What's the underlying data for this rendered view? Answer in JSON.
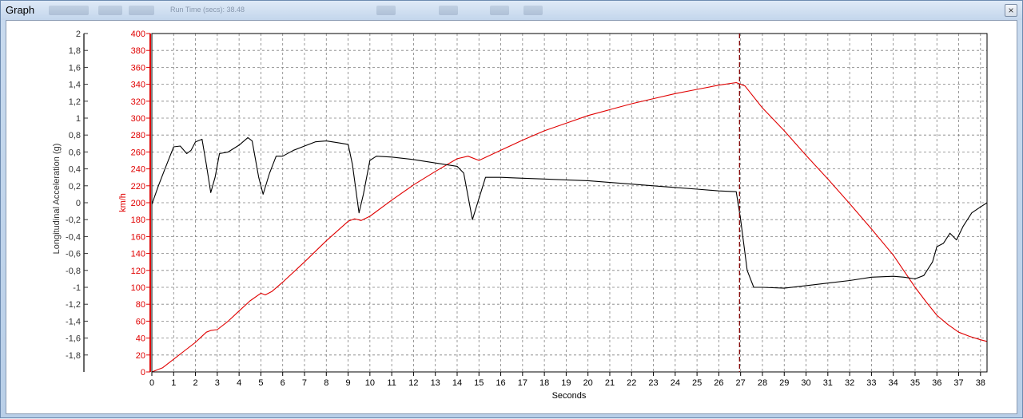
{
  "window": {
    "title": "Graph",
    "header_readout": "Run Time (secs): 38.48",
    "close_glyph": "×"
  },
  "colors": {
    "speed": "#e00000",
    "acceleration": "#000000",
    "grid": "#808080",
    "marker": "#800000"
  },
  "chart_data": {
    "type": "line",
    "title": "",
    "xlabel": "Seconds",
    "xlim": [
      0,
      38.3
    ],
    "x_ticks": [
      0,
      1,
      2,
      3,
      4,
      5,
      6,
      7,
      8,
      9,
      10,
      11,
      12,
      13,
      14,
      15,
      16,
      17,
      18,
      19,
      20,
      21,
      22,
      23,
      24,
      25,
      26,
      27,
      28,
      29,
      30,
      31,
      32,
      33,
      34,
      35,
      36,
      37,
      38
    ],
    "grid": true,
    "cursor_x": 26.95,
    "y_axes": [
      {
        "id": "speed",
        "label": "km/h",
        "color": "#e00000",
        "lim": [
          0,
          400
        ],
        "ticks": [
          "0",
          "20",
          "40",
          "60",
          "80",
          "100",
          "120",
          "140",
          "160",
          "180",
          "200",
          "220",
          "240",
          "260",
          "280",
          "300",
          "320",
          "340",
          "360",
          "380",
          "400"
        ]
      },
      {
        "id": "accel",
        "label": "Longitudinal Acceleration (g)",
        "color": "#333333",
        "lim": [
          -2,
          2
        ],
        "ticks": [
          "-1,8",
          "-1,6",
          "-1,4",
          "-1,2",
          "-1",
          "-0,8",
          "-0,6",
          "-0,4",
          "-0,2",
          "0",
          "0,2",
          "0,4",
          "0,6",
          "0,8",
          "1",
          "1,2",
          "1,4",
          "1,6",
          "1,8",
          "2"
        ]
      }
    ],
    "series": [
      {
        "axis": "speed",
        "color": "#e00000",
        "points": [
          [
            0,
            0
          ],
          [
            0.5,
            5
          ],
          [
            1,
            15
          ],
          [
            1.5,
            25
          ],
          [
            2,
            35
          ],
          [
            2.5,
            47
          ],
          [
            2.7,
            49
          ],
          [
            3,
            50
          ],
          [
            3.5,
            60
          ],
          [
            4,
            72
          ],
          [
            4.5,
            84
          ],
          [
            5,
            93
          ],
          [
            5.2,
            91
          ],
          [
            5.5,
            95
          ],
          [
            6,
            106
          ],
          [
            7,
            130
          ],
          [
            8,
            155
          ],
          [
            9,
            178
          ],
          [
            9.3,
            181
          ],
          [
            9.6,
            179
          ],
          [
            10,
            184
          ],
          [
            11,
            203
          ],
          [
            12,
            221
          ],
          [
            13,
            237
          ],
          [
            14,
            252
          ],
          [
            14.5,
            255
          ],
          [
            15,
            250
          ],
          [
            16,
            262
          ],
          [
            17,
            274
          ],
          [
            18,
            285
          ],
          [
            19,
            294
          ],
          [
            20,
            303
          ],
          [
            21,
            310
          ],
          [
            22,
            317
          ],
          [
            23,
            323
          ],
          [
            24,
            329
          ],
          [
            25,
            334
          ],
          [
            26,
            339
          ],
          [
            26.8,
            342
          ],
          [
            27.2,
            338
          ],
          [
            28,
            312
          ],
          [
            29,
            285
          ],
          [
            30,
            256
          ],
          [
            31,
            228
          ],
          [
            32,
            199
          ],
          [
            33,
            169
          ],
          [
            34,
            138
          ],
          [
            35,
            100
          ],
          [
            35.5,
            83
          ],
          [
            36,
            67
          ],
          [
            36.5,
            56
          ],
          [
            37,
            47
          ],
          [
            37.5,
            42
          ],
          [
            38,
            38
          ],
          [
            38.3,
            36
          ]
        ]
      },
      {
        "axis": "accel",
        "color": "#000000",
        "points": [
          [
            0,
            -0.02
          ],
          [
            0.3,
            0.2
          ],
          [
            0.6,
            0.4
          ],
          [
            1,
            0.66
          ],
          [
            1.3,
            0.67
          ],
          [
            1.6,
            0.58
          ],
          [
            1.8,
            0.62
          ],
          [
            2,
            0.72
          ],
          [
            2.3,
            0.75
          ],
          [
            2.5,
            0.45
          ],
          [
            2.7,
            0.12
          ],
          [
            2.9,
            0.3
          ],
          [
            3.1,
            0.58
          ],
          [
            3.5,
            0.6
          ],
          [
            4,
            0.68
          ],
          [
            4.4,
            0.77
          ],
          [
            4.6,
            0.73
          ],
          [
            4.9,
            0.3
          ],
          [
            5.1,
            0.1
          ],
          [
            5.4,
            0.35
          ],
          [
            5.7,
            0.55
          ],
          [
            6,
            0.55
          ],
          [
            6.5,
            0.62
          ],
          [
            7,
            0.67
          ],
          [
            7.5,
            0.72
          ],
          [
            8,
            0.73
          ],
          [
            8.5,
            0.71
          ],
          [
            9,
            0.69
          ],
          [
            9.2,
            0.45
          ],
          [
            9.5,
            -0.12
          ],
          [
            9.7,
            0.1
          ],
          [
            10,
            0.5
          ],
          [
            10.3,
            0.55
          ],
          [
            11,
            0.54
          ],
          [
            12,
            0.51
          ],
          [
            13,
            0.47
          ],
          [
            14,
            0.43
          ],
          [
            14.3,
            0.35
          ],
          [
            14.7,
            -0.2
          ],
          [
            15,
            0.05
          ],
          [
            15.3,
            0.3
          ],
          [
            16,
            0.3
          ],
          [
            17,
            0.29
          ],
          [
            18,
            0.28
          ],
          [
            19,
            0.27
          ],
          [
            20,
            0.26
          ],
          [
            21,
            0.24
          ],
          [
            22,
            0.22
          ],
          [
            23,
            0.2
          ],
          [
            24,
            0.18
          ],
          [
            25,
            0.16
          ],
          [
            26,
            0.14
          ],
          [
            26.8,
            0.13
          ],
          [
            27,
            -0.2
          ],
          [
            27.3,
            -0.8
          ],
          [
            27.6,
            -1.0
          ],
          [
            28,
            -1.0
          ],
          [
            29,
            -1.01
          ],
          [
            30,
            -0.98
          ],
          [
            31,
            -0.95
          ],
          [
            32,
            -0.92
          ],
          [
            33,
            -0.88
          ],
          [
            34,
            -0.87
          ],
          [
            34.5,
            -0.88
          ],
          [
            35,
            -0.9
          ],
          [
            35.4,
            -0.86
          ],
          [
            35.8,
            -0.7
          ],
          [
            36,
            -0.52
          ],
          [
            36.3,
            -0.48
          ],
          [
            36.6,
            -0.36
          ],
          [
            36.9,
            -0.44
          ],
          [
            37.2,
            -0.28
          ],
          [
            37.6,
            -0.12
          ],
          [
            38,
            -0.05
          ],
          [
            38.3,
            0.0
          ]
        ]
      }
    ]
  }
}
